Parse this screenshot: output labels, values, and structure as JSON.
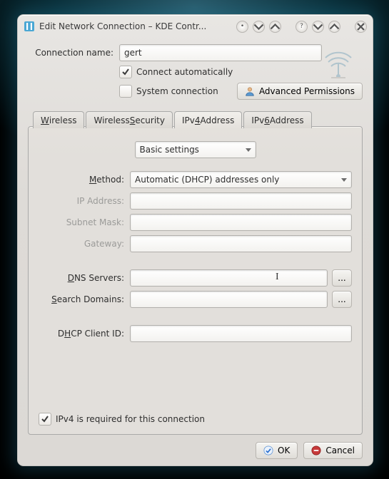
{
  "window": {
    "title": "Edit Network Connection – KDE Contr..."
  },
  "form": {
    "connection_name_label": "Connection name:",
    "connection_name_value": "gert",
    "connect_auto_label": "Connect automatically",
    "connect_auto_checked": true,
    "system_conn_label": "System connection",
    "system_conn_checked": false,
    "advanced_perm_label": "Advanced Permissions"
  },
  "tabs": [
    {
      "label_pre": "",
      "u": "W",
      "label_post": "ireless"
    },
    {
      "label_pre": "Wireless ",
      "u": "S",
      "label_post": "ecurity"
    },
    {
      "label_pre": "IPv",
      "u": "4",
      "label_post": " Address"
    },
    {
      "label_pre": "IPv",
      "u": "6",
      "label_post": " Address"
    }
  ],
  "active_tab": 2,
  "ipv4": {
    "scope_label": "Basic settings",
    "method_label_pre": "",
    "method_u": "M",
    "method_label_post": "ethod:",
    "method_value": "Automatic (DHCP) addresses only",
    "ip_label": "IP Address:",
    "subnet_label": "Subnet Mask:",
    "gateway_label": "Gateway:",
    "dns_label_pre": "",
    "dns_u": "D",
    "dns_label_post": "NS Servers:",
    "dns_value": "",
    "search_label_pre": "",
    "search_u": "S",
    "search_label_post": "earch Domains:",
    "search_value": "",
    "dhcp_label_pre": "D",
    "dhcp_u": "H",
    "dhcp_label_post": "CP Client ID:",
    "dhcp_value": "",
    "required_label_pre": "IPv4 is ",
    "required_u": "r",
    "required_label_post": "equired for this connection",
    "required_checked": true,
    "more": "..."
  },
  "buttons": {
    "ok_pre": "",
    "ok_u": "O",
    "ok_post": "K",
    "cancel_pre": "",
    "cancel_u": "C",
    "cancel_post": "ancel"
  }
}
